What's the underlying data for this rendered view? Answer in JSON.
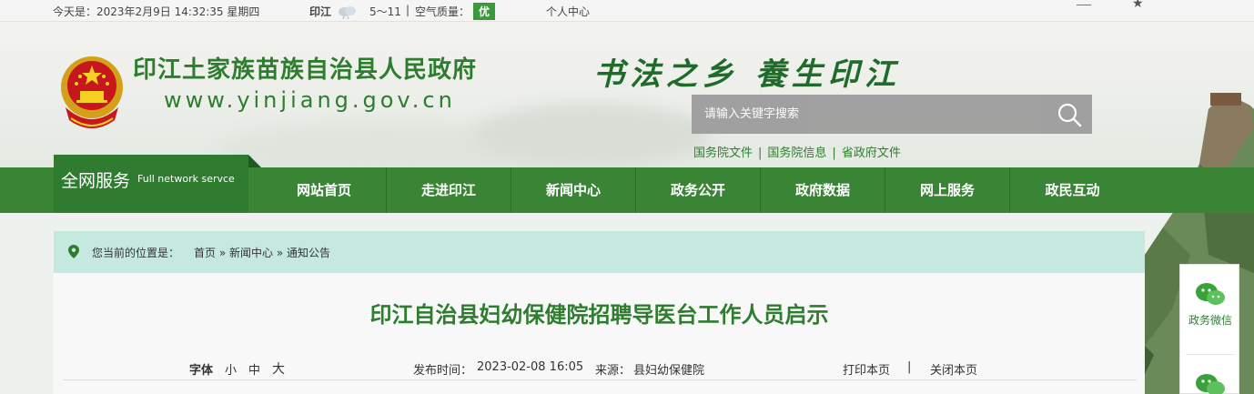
{
  "topbar": {
    "date_text": "今天是：2023年2月9日 14:32:35 星期四",
    "location": "印江",
    "temperature": "5～11",
    "air_label": "空气质量：",
    "air_value": "优",
    "personal_center": "个人中心",
    "air_color": "#3a9a3a"
  },
  "header": {
    "title": "印江土家族苗族自治县人民政府",
    "url": "www.yinjiang.gov.cn",
    "slogan": "书法之乡  養生印江",
    "search": {
      "placeholder": "请输入关键字搜索"
    },
    "quick_links": [
      "国务院文件",
      "国务院信息",
      "省政府文件"
    ],
    "brand_color": "#2e7d2e"
  },
  "nav": {
    "service_main": "全网服务",
    "service_sub": "Full network servce",
    "items": [
      "网站首页",
      "走进印江",
      "新闻中心",
      "政务公开",
      "政府数据",
      "网上服务",
      "政民互动"
    ],
    "bg_color": "#3a8535"
  },
  "breadcrumb": {
    "label": "您当前的位置是：",
    "items": [
      "首页",
      "新闻中心",
      "通知公告"
    ],
    "separator": "»"
  },
  "article": {
    "title": "印江自治县妇幼保健院招聘导医台工作人员启示",
    "font_label": "字体",
    "font_small": "小",
    "font_medium": "中",
    "font_large": "大",
    "publish_label": "发布时间：",
    "publish_time": "2023-02-08 16:05",
    "source_label": "来源：",
    "source": "县妇幼保健院",
    "print": "打印本页",
    "divider": "|",
    "close": "关闭本页"
  },
  "side": {
    "wechat_label": "政务微信"
  }
}
